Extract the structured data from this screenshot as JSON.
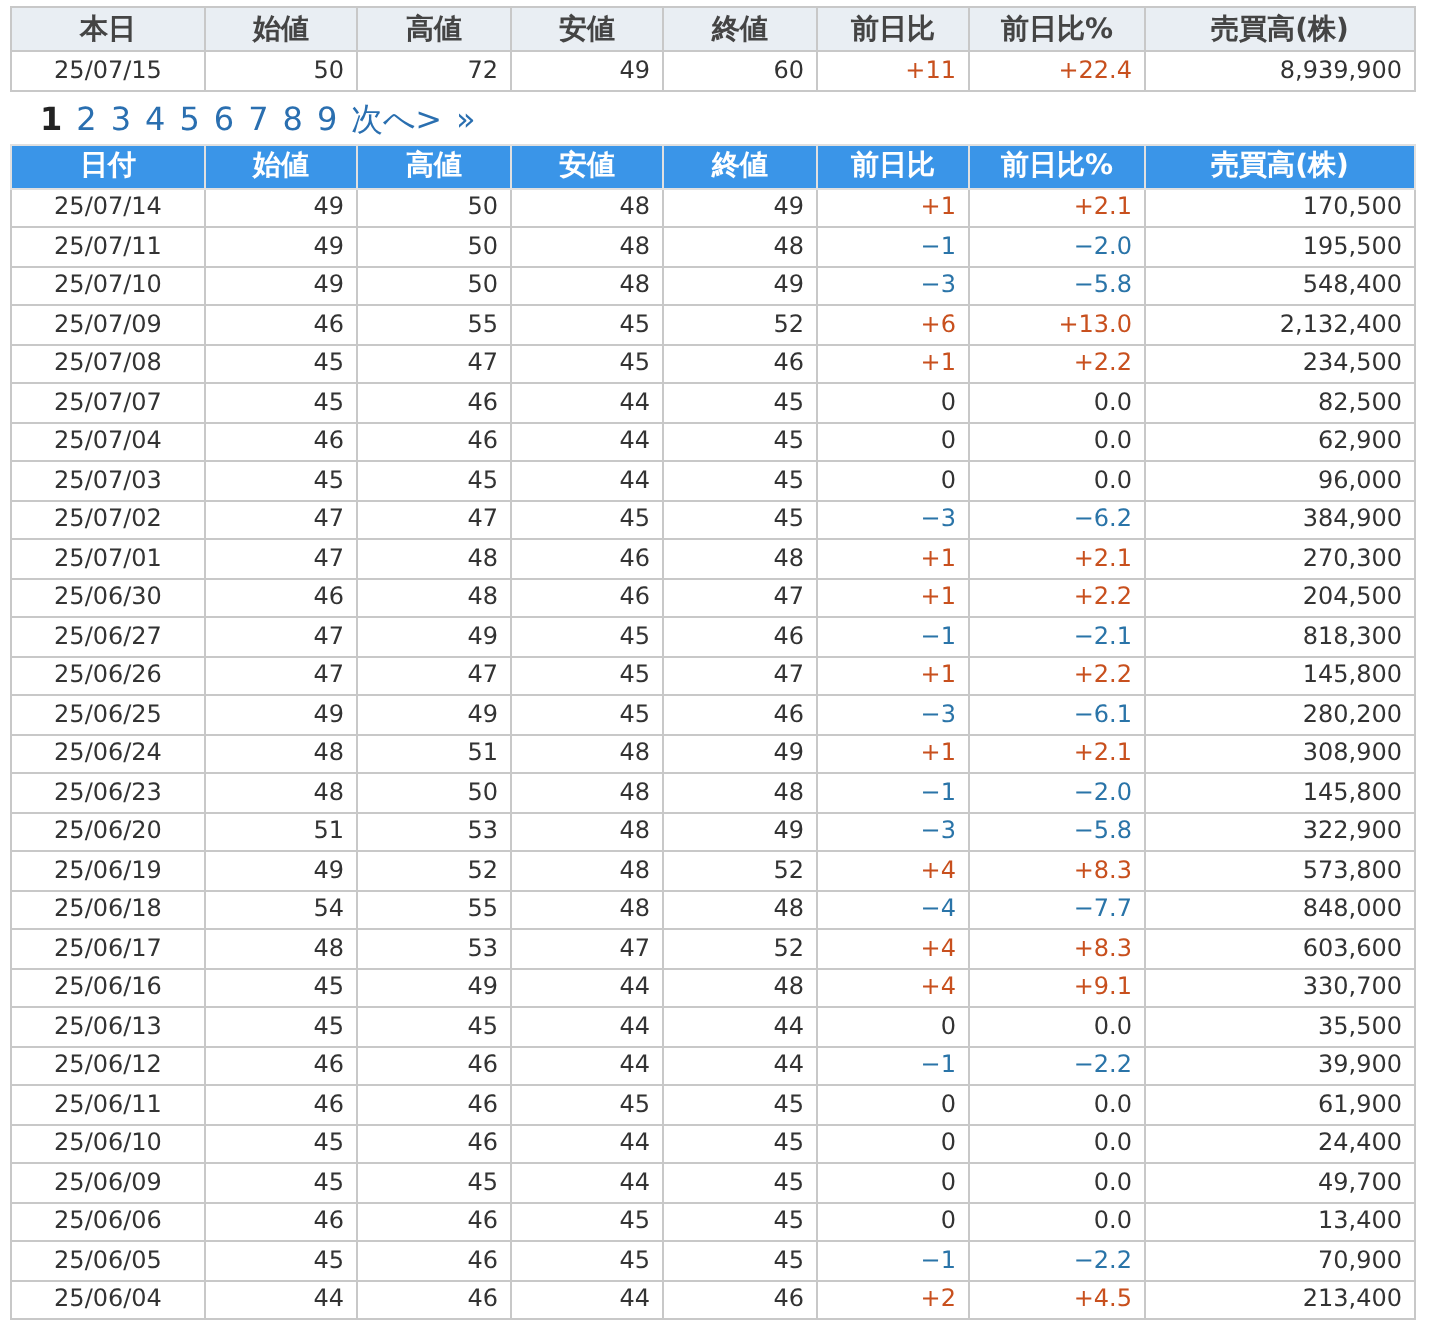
{
  "today_table": {
    "columns": [
      "本日",
      "始値",
      "高値",
      "安値",
      "終値",
      "前日比",
      "前日比%",
      "売買高(株)"
    ],
    "row": {
      "cells": [
        "25/07/15",
        "50",
        "72",
        "49",
        "60",
        "+11",
        "+22.4",
        "8,939,900"
      ],
      "color": "#c8501e"
    }
  },
  "pagination": [
    {
      "label": "1",
      "selected": true
    },
    {
      "label": "2",
      "selected": false
    },
    {
      "label": "3",
      "selected": false
    },
    {
      "label": "4",
      "selected": false
    },
    {
      "label": "5",
      "selected": false
    },
    {
      "label": "6",
      "selected": false
    },
    {
      "label": "7",
      "selected": false
    },
    {
      "label": "8",
      "selected": false
    },
    {
      "label": "9",
      "selected": false
    },
    {
      "label": "次へ>",
      "selected": false
    },
    {
      "label": "»",
      "selected": false
    }
  ],
  "history_table": {
    "columns": [
      "日付",
      "始値",
      "高値",
      "安値",
      "終値",
      "前日比",
      "前日比%",
      "売買高(株)"
    ],
    "rows": [
      {
        "cells": [
          "25/07/14",
          "49",
          "50",
          "48",
          "49",
          "+1",
          "+2.1",
          "170,500"
        ],
        "color": "#c8501e"
      },
      {
        "cells": [
          "25/07/11",
          "49",
          "50",
          "48",
          "48",
          "−1",
          "−2.0",
          "195,500"
        ],
        "color": "#2a74a8"
      },
      {
        "cells": [
          "25/07/10",
          "49",
          "50",
          "48",
          "49",
          "−3",
          "−5.8",
          "548,400"
        ],
        "color": "#2a74a8"
      },
      {
        "cells": [
          "25/07/09",
          "46",
          "55",
          "45",
          "52",
          "+6",
          "+13.0",
          "2,132,400"
        ],
        "color": "#c8501e"
      },
      {
        "cells": [
          "25/07/08",
          "45",
          "47",
          "45",
          "46",
          "+1",
          "+2.2",
          "234,500"
        ],
        "color": "#c8501e"
      },
      {
        "cells": [
          "25/07/07",
          "45",
          "46",
          "44",
          "45",
          "0",
          "0.0",
          "82,500"
        ],
        "color": "#333333"
      },
      {
        "cells": [
          "25/07/04",
          "46",
          "46",
          "44",
          "45",
          "0",
          "0.0",
          "62,900"
        ],
        "color": "#333333"
      },
      {
        "cells": [
          "25/07/03",
          "45",
          "45",
          "44",
          "45",
          "0",
          "0.0",
          "96,000"
        ],
        "color": "#333333"
      },
      {
        "cells": [
          "25/07/02",
          "47",
          "47",
          "45",
          "45",
          "−3",
          "−6.2",
          "384,900"
        ],
        "color": "#2a74a8"
      },
      {
        "cells": [
          "25/07/01",
          "47",
          "48",
          "46",
          "48",
          "+1",
          "+2.1",
          "270,300"
        ],
        "color": "#c8501e"
      },
      {
        "cells": [
          "25/06/30",
          "46",
          "48",
          "46",
          "47",
          "+1",
          "+2.2",
          "204,500"
        ],
        "color": "#c8501e"
      },
      {
        "cells": [
          "25/06/27",
          "47",
          "49",
          "45",
          "46",
          "−1",
          "−2.1",
          "818,300"
        ],
        "color": "#2a74a8"
      },
      {
        "cells": [
          "25/06/26",
          "47",
          "47",
          "45",
          "47",
          "+1",
          "+2.2",
          "145,800"
        ],
        "color": "#c8501e"
      },
      {
        "cells": [
          "25/06/25",
          "49",
          "49",
          "45",
          "46",
          "−3",
          "−6.1",
          "280,200"
        ],
        "color": "#2a74a8"
      },
      {
        "cells": [
          "25/06/24",
          "48",
          "51",
          "48",
          "49",
          "+1",
          "+2.1",
          "308,900"
        ],
        "color": "#c8501e"
      },
      {
        "cells": [
          "25/06/23",
          "48",
          "50",
          "48",
          "48",
          "−1",
          "−2.0",
          "145,800"
        ],
        "color": "#2a74a8"
      },
      {
        "cells": [
          "25/06/20",
          "51",
          "53",
          "48",
          "49",
          "−3",
          "−5.8",
          "322,900"
        ],
        "color": "#2a74a8"
      },
      {
        "cells": [
          "25/06/19",
          "49",
          "52",
          "48",
          "52",
          "+4",
          "+8.3",
          "573,800"
        ],
        "color": "#c8501e"
      },
      {
        "cells": [
          "25/06/18",
          "54",
          "55",
          "48",
          "48",
          "−4",
          "−7.7",
          "848,000"
        ],
        "color": "#2a74a8"
      },
      {
        "cells": [
          "25/06/17",
          "48",
          "53",
          "47",
          "52",
          "+4",
          "+8.3",
          "603,600"
        ],
        "color": "#c8501e"
      },
      {
        "cells": [
          "25/06/16",
          "45",
          "49",
          "44",
          "48",
          "+4",
          "+9.1",
          "330,700"
        ],
        "color": "#c8501e"
      },
      {
        "cells": [
          "25/06/13",
          "45",
          "45",
          "44",
          "44",
          "0",
          "0.0",
          "35,500"
        ],
        "color": "#333333"
      },
      {
        "cells": [
          "25/06/12",
          "46",
          "46",
          "44",
          "44",
          "−1",
          "−2.2",
          "39,900"
        ],
        "color": "#2a74a8"
      },
      {
        "cells": [
          "25/06/11",
          "46",
          "46",
          "45",
          "45",
          "0",
          "0.0",
          "61,900"
        ],
        "color": "#333333"
      },
      {
        "cells": [
          "25/06/10",
          "45",
          "46",
          "44",
          "45",
          "0",
          "0.0",
          "24,400"
        ],
        "color": "#333333"
      },
      {
        "cells": [
          "25/06/09",
          "45",
          "45",
          "44",
          "45",
          "0",
          "0.0",
          "49,700"
        ],
        "color": "#333333"
      },
      {
        "cells": [
          "25/06/06",
          "46",
          "46",
          "45",
          "45",
          "0",
          "0.0",
          "13,400"
        ],
        "color": "#333333"
      },
      {
        "cells": [
          "25/06/05",
          "45",
          "46",
          "45",
          "45",
          "−1",
          "−2.2",
          "70,900"
        ],
        "color": "#2a74a8"
      },
      {
        "cells": [
          "25/06/04",
          "44",
          "46",
          "44",
          "46",
          "+2",
          "+4.5",
          "213,400"
        ],
        "color": "#c8501e"
      }
    ]
  }
}
